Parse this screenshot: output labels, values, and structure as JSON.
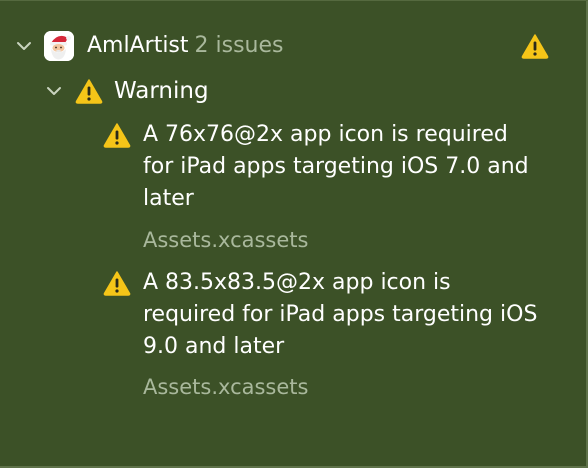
{
  "project": {
    "name": "AmlArtist",
    "issue_count": "2 issues",
    "icon": "santa-app-icon"
  },
  "group": {
    "label": "Warning",
    "icon": "warning-triangle-icon"
  },
  "issues": [
    {
      "message": "A 76x76@2x app icon is required for iPad apps targeting iOS 7.0 and later",
      "file": "Assets.xcassets",
      "icon": "warning-triangle-icon"
    },
    {
      "message": "A 83.5x83.5@2x app icon is required for iPad apps targeting iOS 9.0 and later",
      "file": "Assets.xcassets",
      "icon": "warning-triangle-icon"
    }
  ],
  "colors": {
    "background": "#3c5127",
    "warning_yellow": "#f5c518",
    "secondary_text": "#a9b89c"
  }
}
